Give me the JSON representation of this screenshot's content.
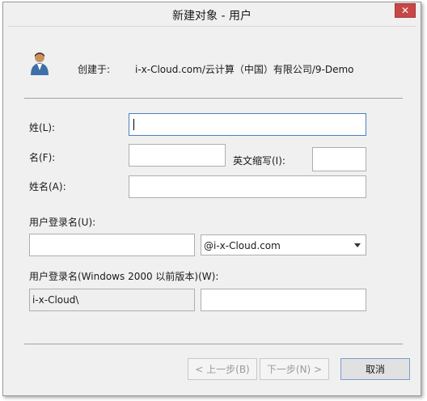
{
  "window": {
    "title": "新建对象 - 用户",
    "close_icon": "close-icon"
  },
  "header": {
    "created_in_label": "创建于:",
    "created_in_path": "i-x-Cloud.com/云计算（中国）有限公司/9-Demo"
  },
  "form": {
    "last_name_label": "姓(L):",
    "first_name_label": "名(F):",
    "initials_label": "英文缩写(I):",
    "full_name_label": "姓名(A):",
    "logon_name_label": "用户登录名(U):",
    "domain_value": "@i-x-Cloud.com",
    "pre2000_label": "用户登录名(Windows 2000 以前版本)(W):",
    "netbios_prefix": "i-x-Cloud\\"
  },
  "buttons": {
    "back": "< 上一步(B)",
    "next": "下一步(N) >",
    "cancel": "取消"
  },
  "colors": {
    "close": "#c74747",
    "focus": "#4a7fc0"
  }
}
